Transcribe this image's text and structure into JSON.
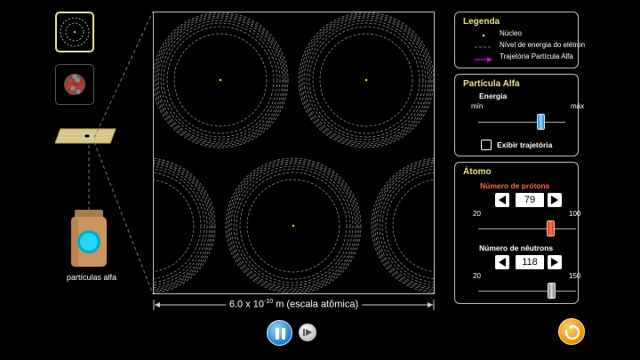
{
  "views": {
    "atom_view_label": "",
    "nucleus_view_label": ""
  },
  "source": {
    "label": "partículas alfa"
  },
  "chamber": {
    "scale_prefix": "6.0 x 10",
    "scale_exponent": "-10",
    "scale_suffix": " m (escala atômica)"
  },
  "legend": {
    "title": "Legenda",
    "items": [
      {
        "label": "Núcleo",
        "icon": "nucleus-dot-icon"
      },
      {
        "label": "Nível de energia do elétron",
        "icon": "dashed-line-icon"
      },
      {
        "label": "Trajetória Partícula Alfa",
        "icon": "magenta-arrow-icon",
        "color": "#e000e0"
      }
    ]
  },
  "alpha": {
    "title": "Partícula Alfa",
    "energy_label": "Energia",
    "min_label": "mín",
    "max_label": "máx",
    "energy_level": 0.72,
    "show_trajectory_label": "Exibir trajetória",
    "show_trajectory_checked": false
  },
  "atom": {
    "title": "Átomo",
    "protons_label": "Número de prótons",
    "protons_value": "79",
    "protons_min": "20",
    "protons_max": "100",
    "protons_fraction": 0.74,
    "neutrons_label": "Número de nêutrons",
    "neutrons_value": "118",
    "neutrons_min": "20",
    "neutrons_max": "150",
    "neutrons_fraction": 0.75
  },
  "colors": {
    "accent_yellow": "#e8e38a",
    "protons_red": "#ff6a4d",
    "play_blue": "#2a7fd0",
    "reset_orange": "#f39200"
  }
}
